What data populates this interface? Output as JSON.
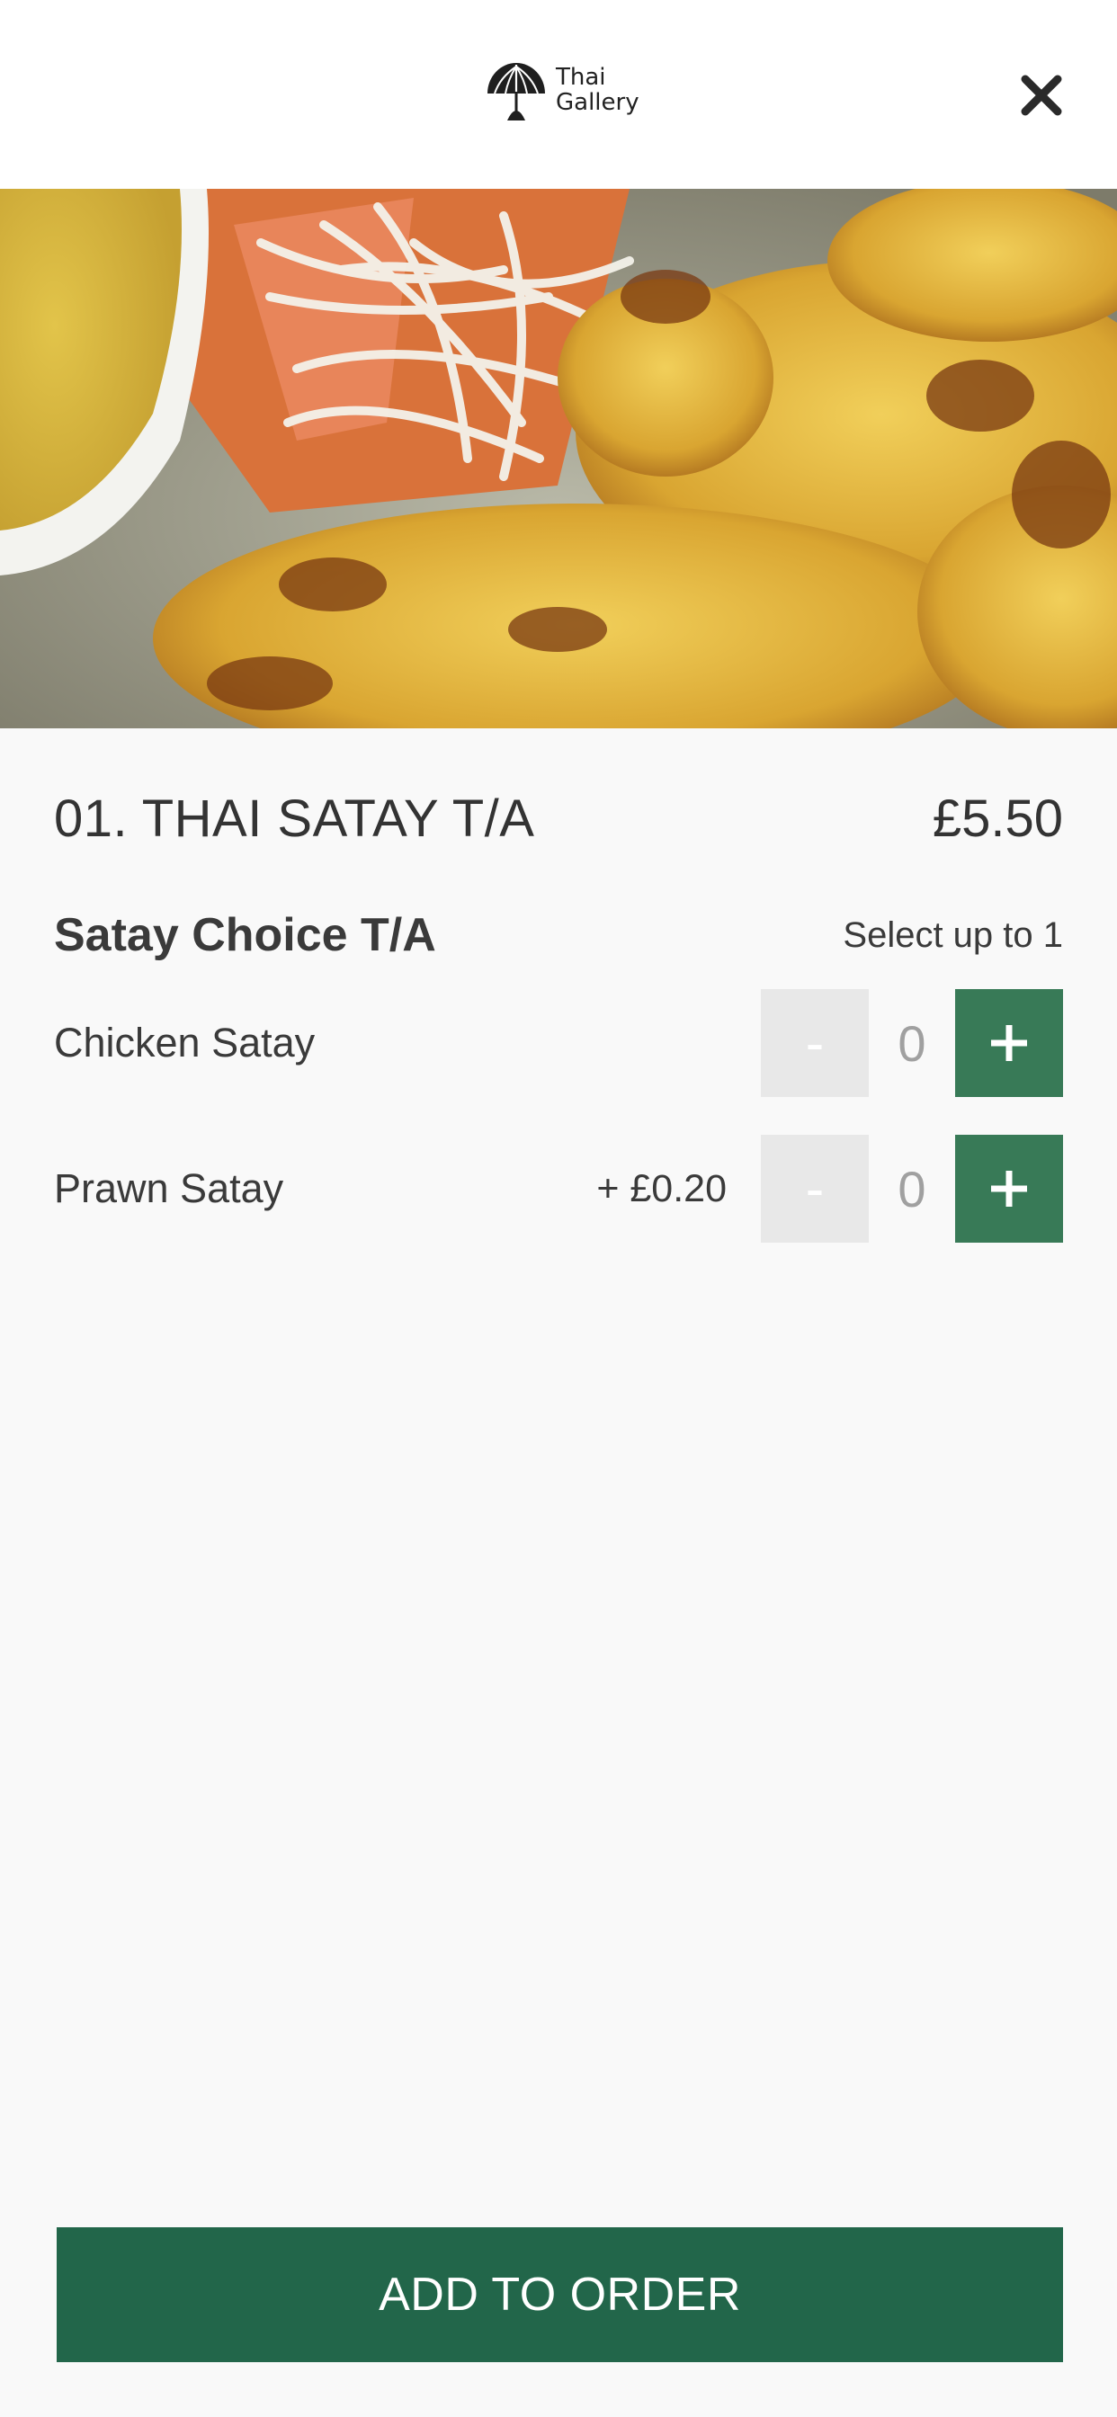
{
  "header": {
    "logo_line1": "Thai",
    "logo_line2": "Gallery",
    "close_icon": "close-icon"
  },
  "item": {
    "title": "01. THAI SATAY T/A",
    "price": "£5.50"
  },
  "option_group": {
    "title": "Satay Choice T/A",
    "limit": "Select up to 1",
    "options": [
      {
        "label": "Chicken Satay",
        "extra": "",
        "count": "0",
        "minus": "-",
        "plus": "+"
      },
      {
        "label": "Prawn Satay",
        "extra": "+ £0.20",
        "count": "0",
        "minus": "-",
        "plus": "+"
      }
    ]
  },
  "footer": {
    "add_label": "ADD TO ORDER"
  },
  "colors": {
    "accent": "#387a57",
    "button": "#22664a",
    "stepper_disabled": "#e8e8e8",
    "background": "#f9f9f9"
  }
}
